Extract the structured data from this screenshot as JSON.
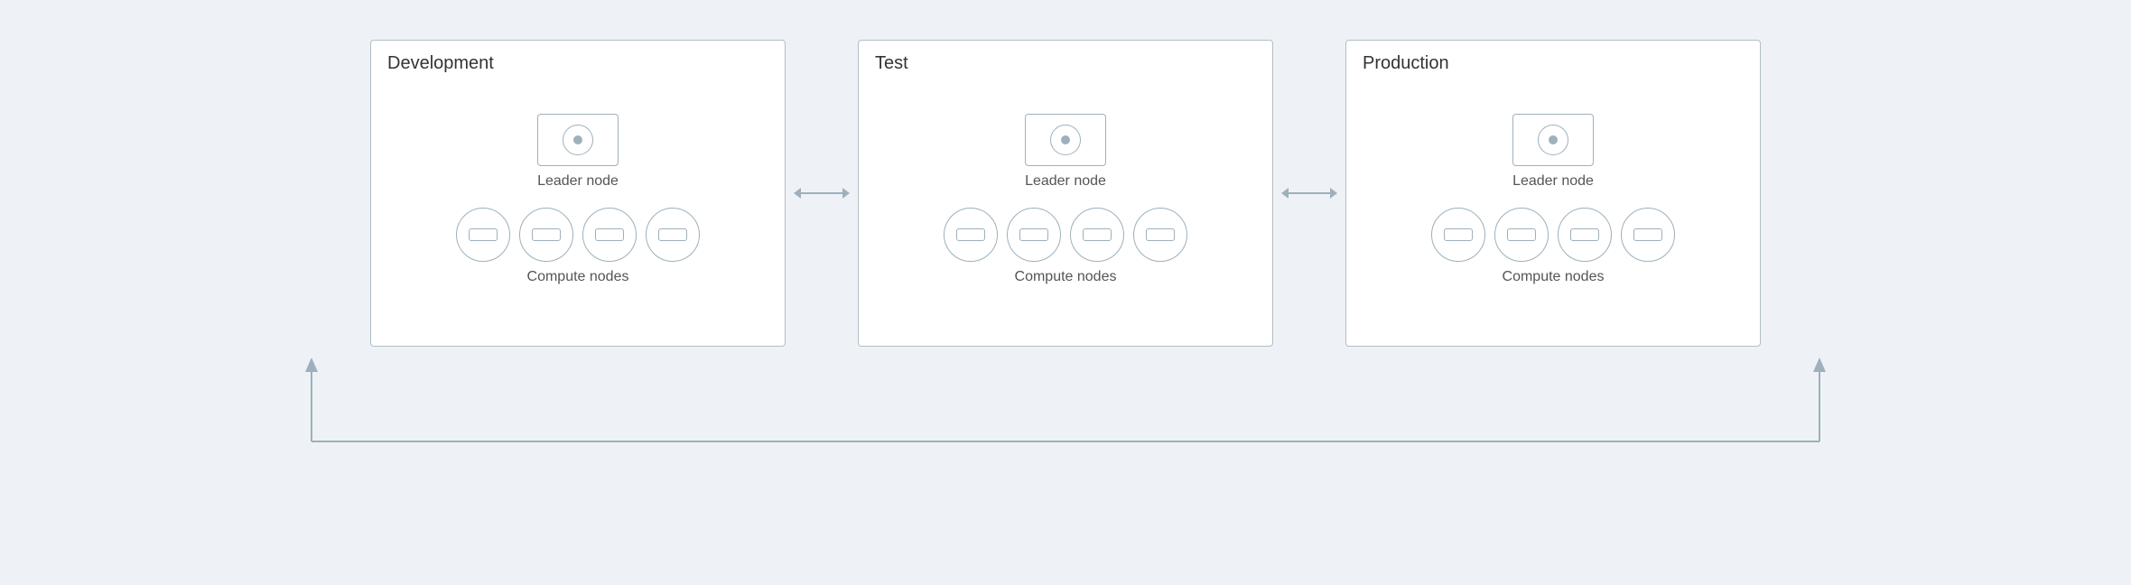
{
  "environments": [
    {
      "id": "development",
      "title": "Development",
      "leader_label": "Leader node",
      "compute_label": "Compute nodes",
      "compute_count": 4
    },
    {
      "id": "test",
      "title": "Test",
      "leader_label": "Leader node",
      "compute_label": "Compute nodes",
      "compute_count": 4
    },
    {
      "id": "production",
      "title": "Production",
      "leader_label": "Leader node",
      "compute_label": "Compute nodes",
      "compute_count": 4
    }
  ],
  "arrows": {
    "horizontal_1": "↔",
    "horizontal_2": "↔"
  },
  "colors": {
    "background": "#eef2f7",
    "box_border": "#b0bec5",
    "icon_border": "#9eb0bb",
    "text": "#333333",
    "label": "#555555"
  }
}
